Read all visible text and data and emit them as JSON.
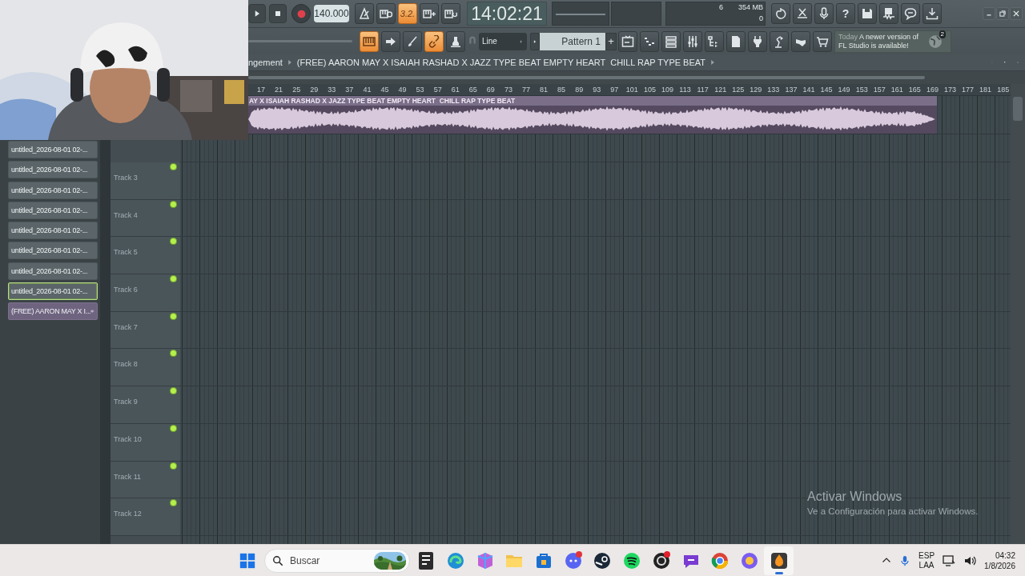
{
  "toolbar": {
    "tempo": "140.000",
    "mode_buttons": [
      {
        "on": false
      },
      {
        "on": false
      },
      {
        "on": true,
        "label": "3.2."
      },
      {
        "on": false
      },
      {
        "on": false
      }
    ],
    "time": "14:02:21",
    "monitor": {
      "cpu": "6",
      "memory": "354 MB",
      "polyphony": "0"
    },
    "action_buttons": [
      {
        "on": false
      },
      {
        "on": false
      },
      {
        "on": false
      },
      {
        "on": false,
        "label": "?"
      },
      {
        "on": false
      },
      {
        "on": false
      },
      {
        "on": false
      },
      {
        "on": false
      }
    ],
    "tool_buttons": [
      {
        "on": true
      },
      {
        "on": false
      },
      {
        "on": false
      },
      {
        "on": true
      },
      {
        "on": false
      }
    ],
    "snap": "Line",
    "pattern": {
      "name": "Pattern 1",
      "add": "+"
    },
    "view_buttons": [
      {
        "on": false
      },
      {
        "on": false
      },
      {
        "on": false
      },
      {
        "on": false
      },
      {
        "on": false
      },
      {
        "on": false
      },
      {
        "on": false
      },
      {
        "on": false
      },
      {
        "on": false
      },
      {
        "on": false
      }
    ],
    "hint": {
      "date": "Today",
      "message": "A newer version of FL Studio is available!",
      "badge": "2"
    }
  },
  "playlist": {
    "breadcrumb": "ngement",
    "title": "(FREE) AARON MAY X ISAIAH RASHAD X JAZZ TYPE BEAT EMPTY HEART  CHILL RAP TYPE BEAT",
    "ruler": [
      "17",
      "21",
      "25",
      "29",
      "33",
      "37",
      "41",
      "45",
      "49",
      "53",
      "57",
      "61",
      "65",
      "69",
      "73",
      "77",
      "81",
      "85",
      "89",
      "93",
      "97",
      "101",
      "105",
      "109",
      "113",
      "117",
      "121",
      "125",
      "129",
      "133",
      "137",
      "141",
      "145",
      "149",
      "153",
      "157",
      "161",
      "165",
      "169",
      "173",
      "177",
      "181",
      "185"
    ],
    "clip": {
      "name": "AY X ISAIAH RASHAD X JAZZ TYPE BEAT EMPTY HEART  CHILL RAP TYPE BEAT"
    },
    "tracks": [
      {
        "name": "Track 3",
        "on": true
      },
      {
        "name": "Track 4",
        "on": true
      },
      {
        "name": "Track 5",
        "on": true
      },
      {
        "name": "Track 6",
        "on": true
      },
      {
        "name": "Track 7",
        "on": true
      },
      {
        "name": "Track 8",
        "on": true
      },
      {
        "name": "Track 9",
        "on": true
      },
      {
        "name": "Track 10",
        "on": true
      },
      {
        "name": "Track 11",
        "on": true
      },
      {
        "name": "Track 12",
        "on": true
      }
    ]
  },
  "clip_list": [
    {
      "name": "untitled_2026-08-01 02-...",
      "kind": "pattern",
      "selected": false
    },
    {
      "name": "untitled_2026-08-01 02-...",
      "kind": "pattern",
      "selected": false
    },
    {
      "name": "untitled_2026-08-01 02-...",
      "kind": "pattern",
      "selected": false
    },
    {
      "name": "untitled_2026-08-01 02-...",
      "kind": "pattern",
      "selected": false
    },
    {
      "name": "untitled_2026-08-01 02-...",
      "kind": "pattern",
      "selected": false
    },
    {
      "name": "untitled_2026-08-01 02-...",
      "kind": "pattern",
      "selected": false
    },
    {
      "name": "untitled_2026-08-01 02-...",
      "kind": "pattern",
      "selected": false
    },
    {
      "name": "untitled_2026-08-01 02-...",
      "kind": "pattern",
      "selected": true
    },
    {
      "name": "(FREE) AARON MAY X I...",
      "kind": "audio",
      "selected": false
    }
  ],
  "activation_notice": {
    "title": "Activar Windows",
    "message": "Ve a Configuración para activar Windows."
  },
  "taskbar": {
    "search_placeholder": "Buscar",
    "language": "ESP",
    "layout": "LAA",
    "time": "04:32",
    "date": "1/8/2026"
  }
}
